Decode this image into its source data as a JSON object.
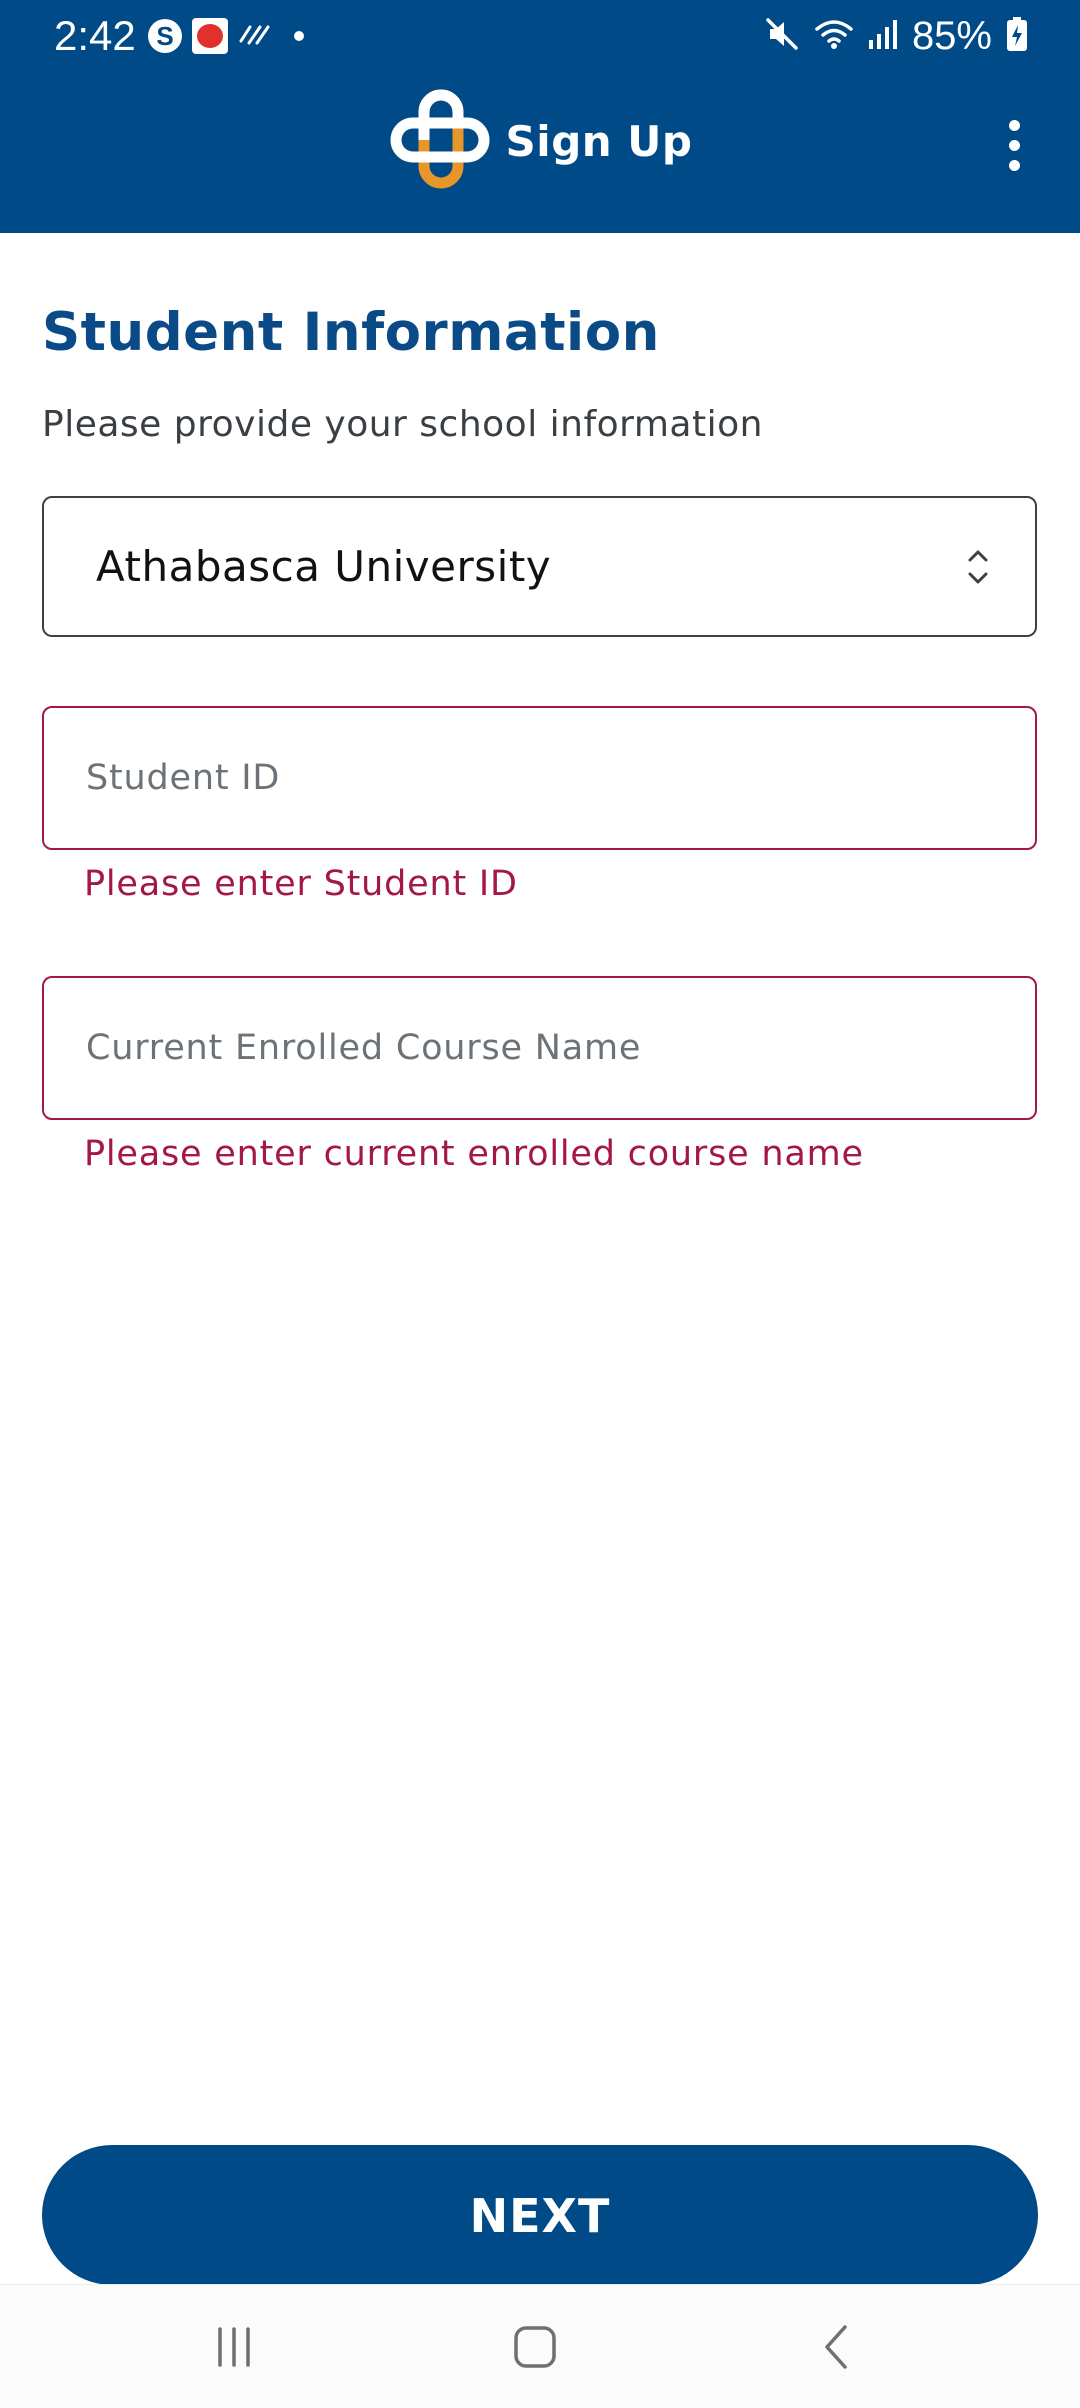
{
  "status_bar": {
    "time": "2:42",
    "battery": "85%",
    "left_icons": [
      "skype-icon",
      "app-notification-icon",
      "activity-icon",
      "dot-icon"
    ],
    "right_icons": [
      "mute-icon",
      "wifi-icon",
      "signal-icon",
      "battery-charging-icon"
    ]
  },
  "app_bar": {
    "title": "Sign Up",
    "logo_icon": "cross-logo-icon",
    "menu_icon": "more-vert-icon"
  },
  "form": {
    "title": "Student Information",
    "subtitle": "Please provide your school information",
    "school_select": {
      "value": "Athabasca University"
    },
    "student_id": {
      "placeholder": "Student ID",
      "value": "",
      "error": "Please enter Student ID"
    },
    "course_name": {
      "placeholder": "Current Enrolled Course Name",
      "value": "",
      "error": "Please enter current enrolled course name"
    },
    "next_label": "NEXT"
  },
  "nav_bar": {
    "icons": [
      "recents-icon",
      "home-icon",
      "back-icon"
    ]
  },
  "colors": {
    "primary": "#004a87",
    "logo_orange": "#e8952a",
    "error": "#a3174a"
  }
}
